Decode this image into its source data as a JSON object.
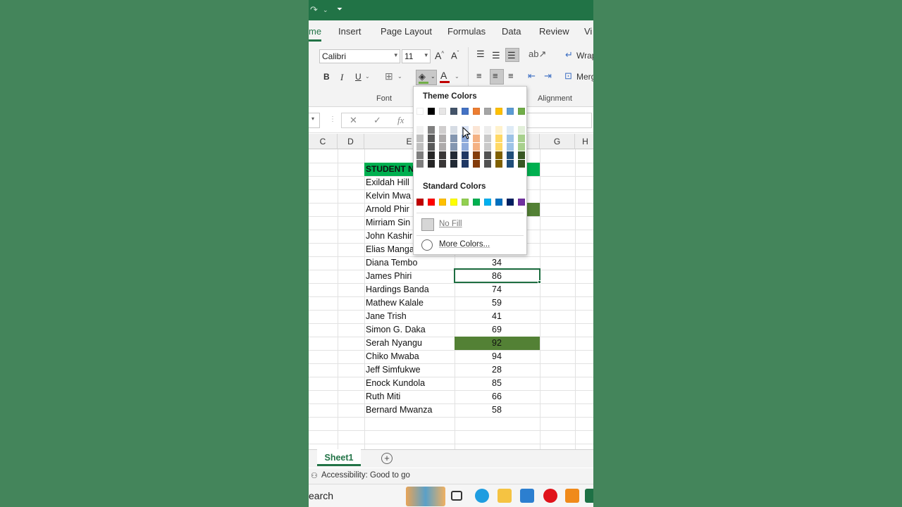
{
  "ribbon": {
    "tabs": [
      "me",
      "Insert",
      "Page Layout",
      "Formulas",
      "Data",
      "Review",
      "Vi"
    ],
    "font_name": "Calibri",
    "font_size": "11",
    "bold": "B",
    "italic": "I",
    "underline": "U",
    "font_color_glyph": "A",
    "group_font": "Font",
    "group_alignment": "Alignment",
    "wrap_text": "Wrap",
    "merge": "Merg",
    "fx": "fx"
  },
  "columns": [
    "C",
    "D",
    "E",
    "G",
    "H"
  ],
  "table": {
    "header": "STUDENT N",
    "rows": [
      {
        "name": "Exildah Hill",
        "score": ""
      },
      {
        "name": "Kelvin Mwa",
        "score": ""
      },
      {
        "name": "Arnold Phir",
        "score": ""
      },
      {
        "name": "Mirriam Sin",
        "score": ""
      },
      {
        "name": "John Kashir",
        "score": ""
      },
      {
        "name": "Elias Manga",
        "score": ""
      },
      {
        "name": "Diana Tembo",
        "score": "34"
      },
      {
        "name": "James Phiri",
        "score": "86"
      },
      {
        "name": "Hardings Banda",
        "score": "74"
      },
      {
        "name": "Mathew Kalale",
        "score": "59"
      },
      {
        "name": "Jane Trish",
        "score": "41"
      },
      {
        "name": "Simon G. Daka",
        "score": "69"
      },
      {
        "name": "Serah Nyangu",
        "score": "92"
      },
      {
        "name": "Chiko Mwaba",
        "score": "94"
      },
      {
        "name": "Jeff Simfukwe",
        "score": "28"
      },
      {
        "name": "Enock Kundola",
        "score": "85"
      },
      {
        "name": "Ruth Miti",
        "score": "66"
      },
      {
        "name": "Bernard Mwanza",
        "score": "58"
      }
    ]
  },
  "color_picker": {
    "theme_title": "Theme Colors",
    "standard_title": "Standard Colors",
    "no_fill": "No Fill",
    "more_colors": "More Colors...",
    "theme_colors": [
      "#ffffff",
      "#000000",
      "#e7e6e6",
      "#44546a",
      "#4472c4",
      "#ed7d31",
      "#a5a5a5",
      "#ffc000",
      "#5b9bd5",
      "#70ad47"
    ],
    "standard_colors": [
      "#c00000",
      "#ff0000",
      "#ffc000",
      "#ffff00",
      "#92d050",
      "#00b050",
      "#00b0f0",
      "#0070c0",
      "#002060",
      "#7030a0"
    ]
  },
  "sheet": {
    "tab": "Sheet1",
    "add": "+"
  },
  "status": {
    "accessibility": "Accessibility: Good to go"
  },
  "taskbar": {
    "search": "earch"
  },
  "colors": {
    "excel_green": "#217346",
    "header_fill": "#00b050",
    "cell_fill": "#538135"
  }
}
